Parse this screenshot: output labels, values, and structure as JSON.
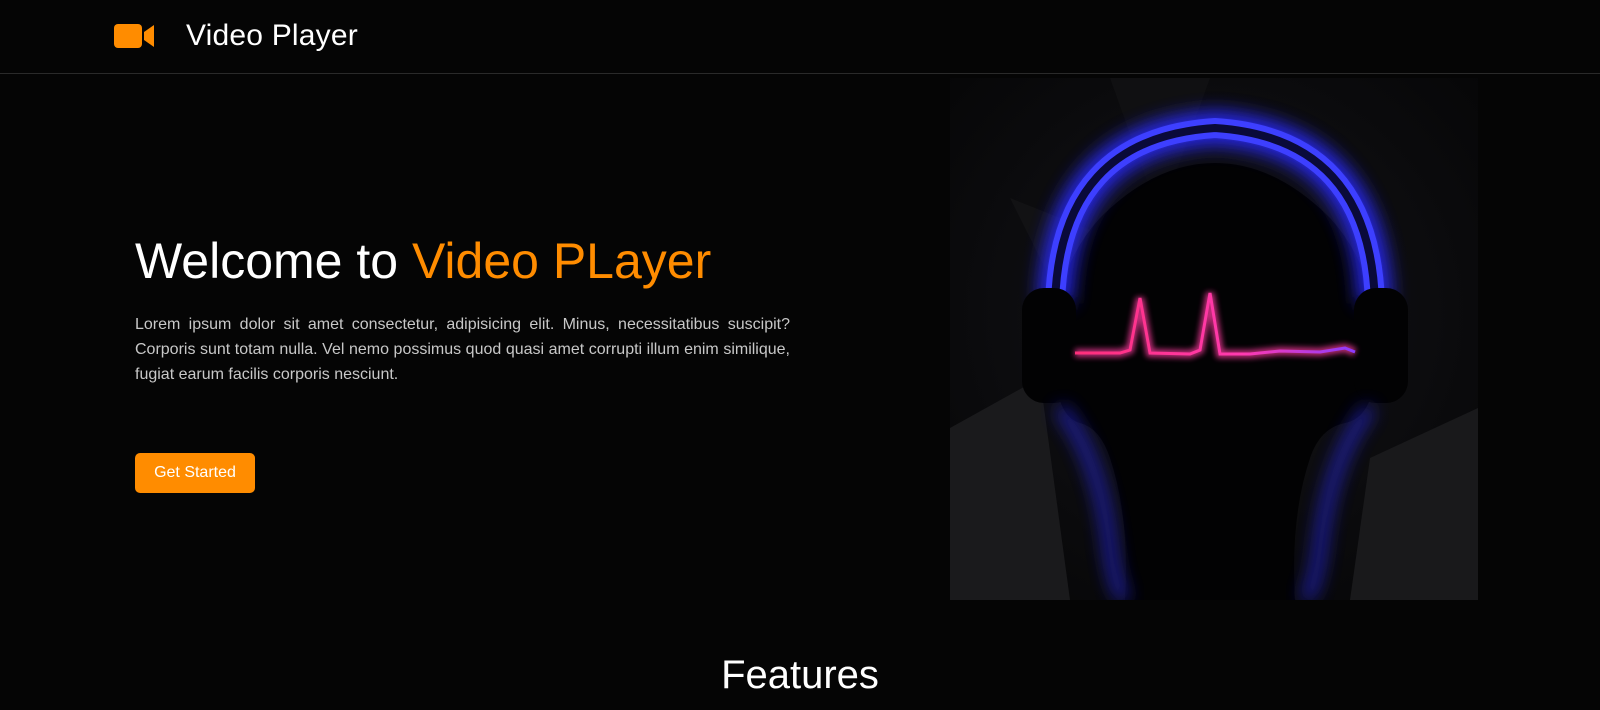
{
  "navbar": {
    "brand_icon": "video-camera-icon",
    "brand_title": "Video Player"
  },
  "hero": {
    "title_prefix": "Welcome to ",
    "title_accent": "Video PLayer",
    "description": "Lorem ipsum dolor sit amet consectetur, adipisicing elit. Minus, necessitatibus suscipit? Corporis sunt totam nulla. Vel nemo possimus quod quasi amet corrupti illum enim similique, fugiat earum facilis corporis nesciunt.",
    "cta_label": "Get Started",
    "image_subject": "headphones-neon-illustration"
  },
  "features": {
    "heading": "Features"
  },
  "colors": {
    "accent": "#ff8c00",
    "background": "#050505",
    "text": "#ffffff",
    "muted_text": "#c8c8c8",
    "neon_blue": "#2a2cff",
    "neon_pink": "#ff3aa0"
  }
}
